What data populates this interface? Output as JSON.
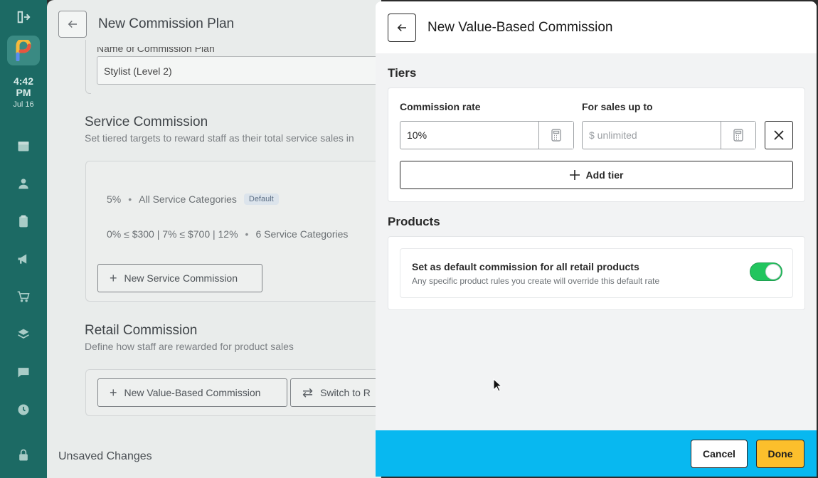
{
  "rail": {
    "time": "4:42",
    "ampm": "PM",
    "date": "Jul 16",
    "icons": [
      "exit-icon",
      "logo-icon",
      "calendar-icon",
      "user-icon",
      "clipboard-icon",
      "megaphone-icon",
      "cart-icon",
      "layers-icon",
      "chat-icon",
      "clock-icon",
      "lock-icon"
    ]
  },
  "background_page": {
    "title": "New Commission Plan",
    "plan_name_label": "Name of Commission Plan",
    "plan_name_value": "Stylist (Level 2)",
    "service": {
      "title": "Service Commission",
      "subtitle": "Set tiered targets to reward staff as their total service sales in",
      "rows": [
        {
          "rate": "5%",
          "scope": "All Service Categories",
          "badge": "Default"
        },
        {
          "rate": "0% ≤ $300 | 7% ≤ $700 | 12%",
          "scope": "6 Service Categories"
        }
      ],
      "new_button": "New Service Commission"
    },
    "retail": {
      "title": "Retail Commission",
      "subtitle": "Define how staff are rewarded for product sales",
      "new_button": "New Value-Based Commission",
      "switch_button": "Switch to R"
    },
    "unsaved": "Unsaved Changes"
  },
  "drawer": {
    "title": "New Value-Based Commission",
    "tiers": {
      "title": "Tiers",
      "commission_label": "Commission rate",
      "commission_value": "10%",
      "sales_label": "For sales up to",
      "sales_placeholder": "$ unlimited",
      "sales_value": "",
      "add_tier": "Add tier"
    },
    "products": {
      "title": "Products",
      "default_title": "Set as default commission for all retail products",
      "default_sub": "Any specific product rules you create will override this default rate",
      "toggle_on": true
    },
    "footer": {
      "cancel": "Cancel",
      "done": "Done"
    }
  },
  "colors": {
    "footer": "#08b8f0",
    "done": "#fcbf2c",
    "toggle": "#22c55e",
    "rail": "#1c6a64"
  }
}
